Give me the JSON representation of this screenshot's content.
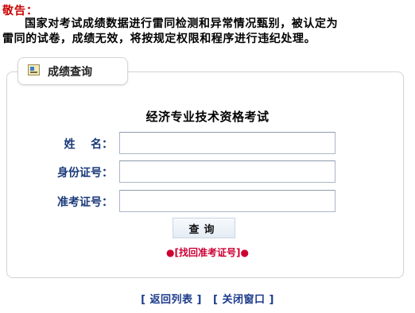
{
  "warning": {
    "title": "敬告：",
    "line1": "国家对考试成绩数据进行雷同检测和异常情况甄别，被认定为",
    "line2": "雷同的试卷，成绩无效，将按规定权限和程序进行违纪处理。"
  },
  "panel": {
    "tab_label": "成绩查询",
    "tab_icon": "certificate-icon",
    "exam_title": "经济专业技术资格考试"
  },
  "form": {
    "name_label": "姓    名：",
    "name_value": "",
    "id_label": "身份证号：",
    "id_value": "",
    "ticket_label": "准考证号：",
    "ticket_value": "",
    "query_button": "查询"
  },
  "recover": {
    "bullet_left": "●",
    "label": "[找回准考证号]",
    "bullet_right": "●"
  },
  "footer": {
    "back_label": "[ 返回列表 ]",
    "close_label": "[ 关闭窗口 ]"
  },
  "colors": {
    "warning_title": "#cc0000",
    "form_label": "#1a3a7a",
    "recover_link": "#cc0033",
    "footer_link": "#1b3a8c",
    "panel_border": "#d6d6d6"
  }
}
